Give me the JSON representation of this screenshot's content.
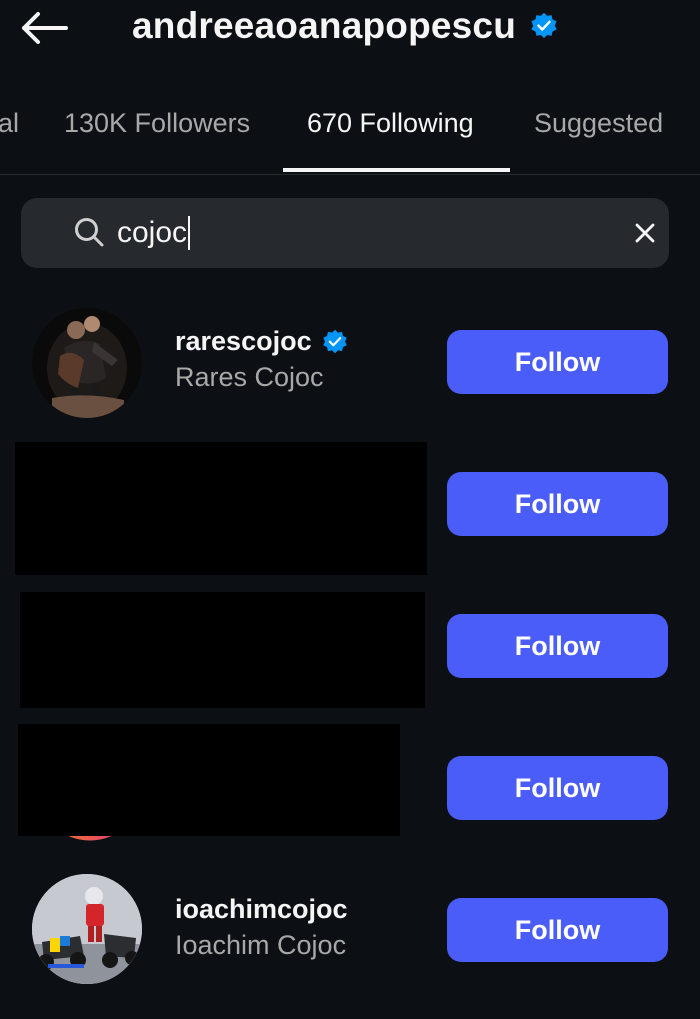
{
  "header": {
    "title": "andreeaoanapopescu",
    "verified": true
  },
  "tabs": [
    {
      "label": "al",
      "active": false
    },
    {
      "label": "130K Followers",
      "active": false
    },
    {
      "label": "670 Following",
      "active": true
    },
    {
      "label": "Suggested",
      "active": false
    }
  ],
  "search": {
    "value": "cojoc"
  },
  "results": [
    {
      "username": "rarescojoc",
      "full_name": "Rares Cojoc",
      "verified": true,
      "button": "Follow"
    },
    {
      "username": "",
      "full_name": "",
      "verified": false,
      "button": "Follow",
      "redacted": true
    },
    {
      "username": "",
      "full_name": "",
      "verified": false,
      "button": "Follow",
      "redacted": true
    },
    {
      "username": "",
      "full_name": "",
      "verified": false,
      "button": "Follow",
      "redacted": true
    },
    {
      "username": "ioachimcojoc",
      "full_name": "Ioachim Cojoc",
      "verified": false,
      "button": "Follow"
    }
  ],
  "colors": {
    "background": "#0c1014",
    "search_bg": "#262a2f",
    "follow_button": "#4a5df9",
    "verified": "#0095f6",
    "secondary_text": "#a8a8a8"
  }
}
